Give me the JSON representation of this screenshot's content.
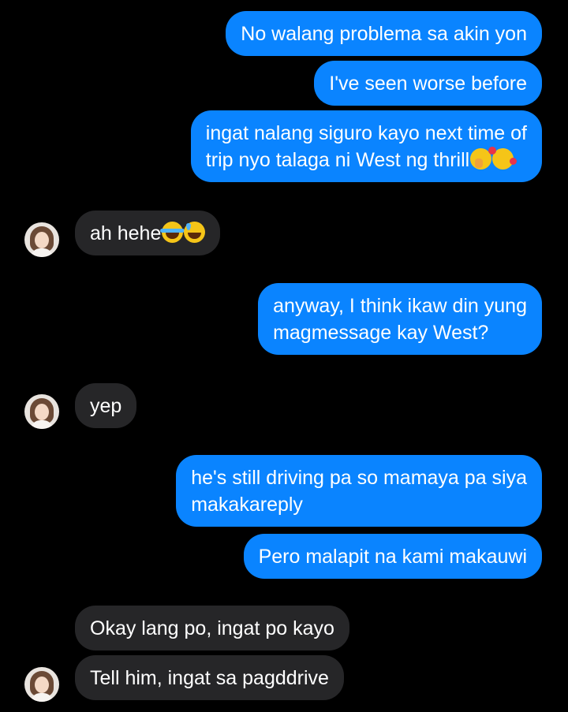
{
  "messages": [
    {
      "direction": "out",
      "lines": [
        "No walang problema sa akin yon"
      ]
    },
    {
      "direction": "out",
      "lines": [
        "I've seen worse before"
      ]
    },
    {
      "direction": "out",
      "lines": [
        "ingat nalang siguro kayo next time of",
        "trip nyo talaga ni West ng thrill"
      ],
      "emoji_icons": [
        "shushing-face-icon",
        "smiling-face-with-hearts-icon"
      ]
    },
    {
      "direction": "in",
      "lines": [
        "ah hehe"
      ],
      "emoji_icons": [
        "face-with-tears-of-joy-icon",
        "grinning-face-with-sweat-icon"
      ]
    },
    {
      "direction": "out",
      "lines": [
        "anyway, I think ikaw din yung",
        "magmessage kay West?"
      ]
    },
    {
      "direction": "in",
      "lines": [
        "yep"
      ]
    },
    {
      "direction": "out",
      "lines": [
        "he's still driving pa so mamaya pa siya",
        "makakareply"
      ]
    },
    {
      "direction": "out",
      "lines": [
        "Pero malapit na kami makauwi"
      ]
    },
    {
      "direction": "in",
      "lines": [
        "Okay lang po, ingat po kayo"
      ]
    },
    {
      "direction": "in",
      "lines": [
        "Tell him, ingat sa pagddrive"
      ]
    }
  ],
  "colors": {
    "background": "#000000",
    "outgoing_bubble": "#0a84ff",
    "incoming_bubble": "#262628",
    "text": "#ffffff"
  }
}
